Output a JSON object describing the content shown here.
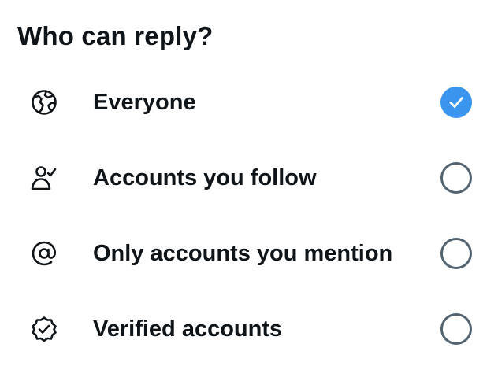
{
  "title": "Who can reply?",
  "options": [
    {
      "label": "Everyone",
      "icon": "globe-icon",
      "selected": true
    },
    {
      "label": "Accounts you follow",
      "icon": "person-check-icon",
      "selected": false
    },
    {
      "label": "Only accounts you mention",
      "icon": "at-sign-icon",
      "selected": false
    },
    {
      "label": "Verified accounts",
      "icon": "verified-badge-icon",
      "selected": false
    }
  ],
  "colors": {
    "accent": "#3a95ee",
    "text": "#0f1419",
    "radio_border": "#536471"
  }
}
